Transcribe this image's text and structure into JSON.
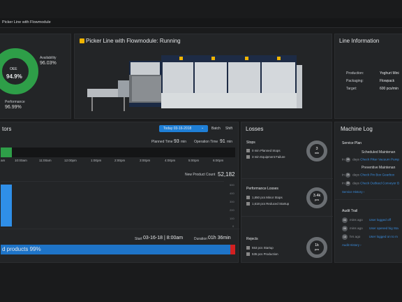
{
  "window_title": "Picker Line with Flowmodule",
  "oee": {
    "center_label": "OEE",
    "center_value": "94.9%",
    "availability_label": "Availability",
    "availability_value": "96.03%",
    "performance_label": "Performance",
    "performance_value": "96.99%"
  },
  "machine": {
    "title": "Picker Line with Flowmodule: Running",
    "status_color": "#f0b400"
  },
  "line_info": {
    "title": "Line Information",
    "rows": [
      {
        "label": "Production:",
        "value": "Yoghurt Mini"
      },
      {
        "label": "Packaging:",
        "value": "Flowpack"
      },
      {
        "label": "Target:",
        "value": "600 pcs/min"
      }
    ]
  },
  "indicators": {
    "title_fragment": "tors",
    "date_button": "Today 03-16-2018",
    "batch_label": "Batch",
    "shift_label": "Shift",
    "planned_time_label": "Planned Time",
    "planned_time_value": "93",
    "planned_time_unit": "min",
    "operation_time_label": "Operation Time",
    "operation_time_value": "91",
    "operation_time_unit": "min",
    "time_ticks": [
      "am",
      "10:00am",
      "11:00am",
      "12:00pm",
      "1:00pm",
      "2:00pm",
      "3:00pm",
      "4:00pm",
      "5:00pm",
      "6:00pm"
    ],
    "product_count_label": "New Product Count",
    "product_count_value": "52,182",
    "y_ticks": [
      "500",
      "400",
      "300",
      "200",
      "100",
      "0"
    ],
    "start_label": "Start",
    "start_value": "03-16-18 | 8:00am",
    "duration_label": "Duration",
    "duration_value": "01h 36min",
    "good_products": "d products 99%"
  },
  "losses": {
    "title": "Losses",
    "stops": {
      "title": "Stops",
      "items": [
        "0  min  Planned Stops",
        "3  min  Equipment Failure"
      ],
      "ring_value": "3",
      "ring_unit": "min"
    },
    "performance": {
      "title": "Performance Losses",
      "items": [
        "1,850  pcs  Minor Stops",
        "1,618  pcs  Reduced Startup"
      ],
      "ring_value": "3.4k",
      "ring_unit": "pcs"
    },
    "rejects": {
      "title": "Rejects",
      "items": [
        "553  pcs  Startup",
        "535  pcs  Production"
      ],
      "ring_value": "1k",
      "ring_unit": "pcs"
    }
  },
  "machine_log": {
    "title": "Machine Log",
    "service_plan_title": "Service Plan",
    "service_items": [
      {
        "title": "Scheduled Maintenan",
        "in": "In",
        "days": "16",
        "days_label": "days",
        "action": "Check Piker Vacuum Pump"
      },
      {
        "title": "Preventive Maintenan",
        "in": "In",
        "days": "24",
        "days_label": "days",
        "action": "Check Pin Box Gearbox"
      },
      {
        "title": "",
        "in": "In",
        "days": "39",
        "days_label": "days",
        "action": "Check Outfeed Conveyor B"
      }
    ],
    "service_history": "Service History ›",
    "audit_title": "Audit Trail",
    "audit_items": [
      {
        "num": "03",
        "unit": "mins ago",
        "text": "User logged off"
      },
      {
        "num": "05",
        "unit": "mins ago",
        "text": "User opened big Sta"
      },
      {
        "num": "13",
        "unit": "hrs ago",
        "text": "User logged on to m"
      }
    ],
    "audit_history": "Audit History ›"
  },
  "colors": {
    "accent": "#2f8fe8",
    "green": "#2e9e48",
    "red": "#d22020",
    "bg": "#1a1b1c",
    "panel": "#232527"
  }
}
